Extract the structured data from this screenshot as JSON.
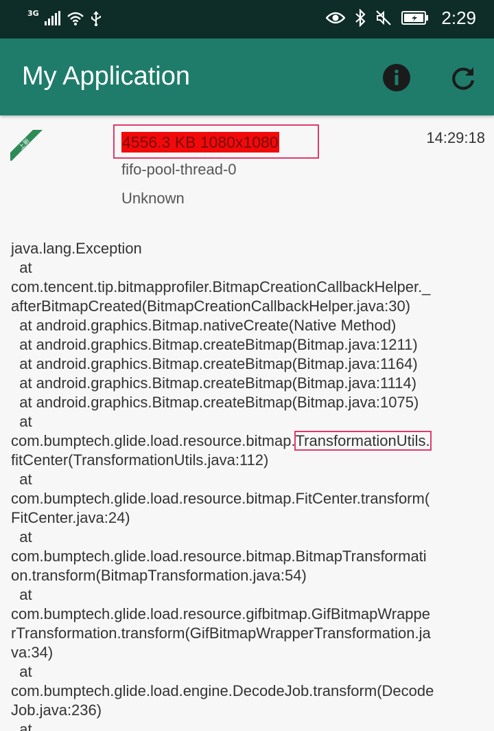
{
  "status_bar": {
    "network_type": "3G",
    "time": "2:29",
    "icons": [
      "signal-icon",
      "wifi-icon",
      "usb-icon",
      "eye-icon",
      "bluetooth-icon",
      "mute-icon",
      "battery-icon"
    ]
  },
  "app_bar": {
    "title": "My Application",
    "background": "#1f7c6b",
    "actions": [
      "info-icon",
      "refresh-icon"
    ]
  },
  "record": {
    "badge": "上新",
    "size": "4556.3 KB 1080x1080",
    "time": "14:29:18",
    "thread": "fifo-pool-thread-0",
    "source": "Unknown"
  },
  "stack": {
    "l1": "java.lang.Exception",
    "l2": "  at",
    "l3": "com.tencent.tip.bitmapprofiler.BitmapCreationCallbackHelper._",
    "l4": "afterBitmapCreated(BitmapCreationCallbackHelper.java:30)",
    "l5": "  at android.graphics.Bitmap.nativeCreate(Native Method)",
    "l6": "  at android.graphics.Bitmap.createBitmap(Bitmap.java:1211)",
    "l7": "  at android.graphics.Bitmap.createBitmap(Bitmap.java:1164)",
    "l8": "  at android.graphics.Bitmap.createBitmap(Bitmap.java:1114)",
    "l9": "  at android.graphics.Bitmap.createBitmap(Bitmap.java:1075)",
    "l10": "  at",
    "l11a": "com.bumptech.glide.load.resource.bitmap.",
    "l11b": "TransformationUtils.",
    "l12": "fitCenter(TransformationUtils.java:112)",
    "l13": "  at",
    "l14": "com.bumptech.glide.load.resource.bitmap.FitCenter.transform(",
    "l15": "FitCenter.java:24)",
    "l16": "  at",
    "l17": "com.bumptech.glide.load.resource.bitmap.BitmapTransformati",
    "l18": "on.transform(BitmapTransformation.java:54)",
    "l19": "  at",
    "l20": "com.bumptech.glide.load.resource.gifbitmap.GifBitmapWrappe",
    "l21": "rTransformation.transform(GifBitmapWrapperTransformation.ja",
    "l22": "va:34)",
    "l23": "  at",
    "l24": "com.bumptech.glide.load.engine.DecodeJob.transform(Decode",
    "l25": "Job.java:236)",
    "l26": "  at"
  }
}
